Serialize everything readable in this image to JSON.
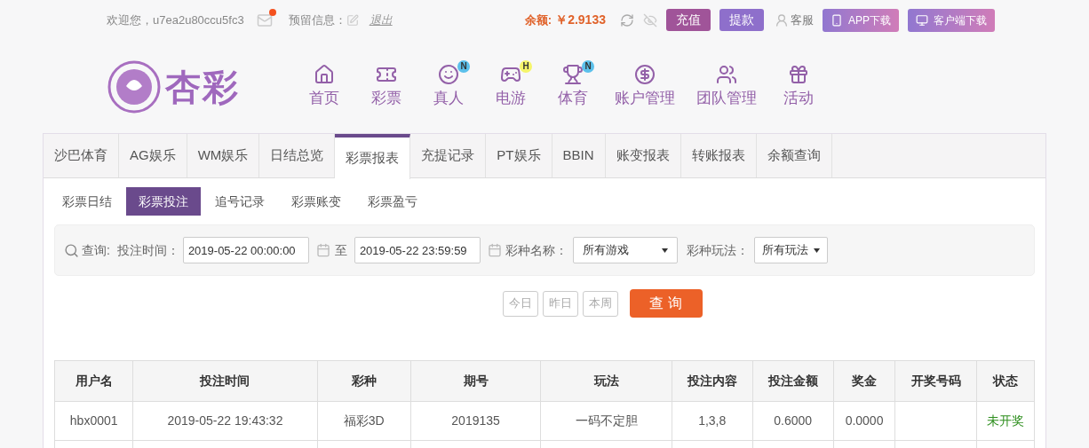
{
  "top_bar": {
    "welcome": "欢迎您，u7ea2u80ccu5fc3",
    "mail_unread": true,
    "reserved_label": "预留信息：",
    "logout": "退出",
    "balance_label": "余额:",
    "balance": "￥2.9133",
    "buttons": [
      {
        "label": "充值",
        "kind": "deposit"
      },
      {
        "label": "提款",
        "kind": "withdraw"
      }
    ],
    "service": "客服",
    "downloads": [
      {
        "label": "APP下载",
        "kind": "phone"
      },
      {
        "label": "客户端下载",
        "kind": "desktop"
      }
    ]
  },
  "logo_text": "杏彩",
  "nav": [
    {
      "label": "首页",
      "kind": "home"
    },
    {
      "label": "彩票",
      "kind": "ticket"
    },
    {
      "label": "真人",
      "kind": "person",
      "badge": "N",
      "color": "#5bc0eb"
    },
    {
      "label": "电游",
      "kind": "gamepad",
      "badge": "H",
      "color": "#f5f56a"
    },
    {
      "label": "体育",
      "kind": "trophy",
      "badge": "N",
      "color": "#5bc0eb"
    },
    {
      "label": "账户管理",
      "kind": "coin"
    },
    {
      "label": "团队管理",
      "kind": "team"
    },
    {
      "label": "活动",
      "kind": "gift"
    }
  ],
  "tabs": [
    {
      "label": "沙巴体育",
      "selected": false
    },
    {
      "label": "AG娱乐",
      "selected": false
    },
    {
      "label": "WM娱乐",
      "selected": false
    },
    {
      "label": "日结总览",
      "selected": false
    },
    {
      "label": "彩票报表",
      "selected": true
    },
    {
      "label": "充提记录",
      "selected": false
    },
    {
      "label": "PT娱乐",
      "selected": false
    },
    {
      "label": "BBIN",
      "selected": false
    },
    {
      "label": "账变报表",
      "selected": false
    },
    {
      "label": "转账报表",
      "selected": false
    },
    {
      "label": "余额查询",
      "selected": false
    }
  ],
  "subtabs": [
    {
      "label": "彩票日结",
      "selected": false
    },
    {
      "label": "彩票投注",
      "selected": true
    },
    {
      "label": "追号记录",
      "selected": false
    },
    {
      "label": "彩票账变",
      "selected": false
    },
    {
      "label": "彩票盈亏",
      "selected": false
    }
  ],
  "filters": {
    "query_label": "查询:",
    "time_label": "投注时间：",
    "start": "2019-05-22 00:00:00",
    "to": "至",
    "end": "2019-05-22 23:59:59",
    "game_label": "彩种名称：",
    "game": "所有游戏",
    "play_label": "彩种玩法：",
    "play": "所有玩法"
  },
  "quick_buttons": [
    "今日",
    "昨日",
    "本周"
  ],
  "search_button": "查 询",
  "table": {
    "columns": [
      "用户名",
      "投注时间",
      "彩种",
      "期号",
      "玩法",
      "投注内容",
      "投注金额",
      "奖金",
      "开奖号码",
      "状态"
    ],
    "rows": [
      {
        "cells": [
          "hbx0001",
          "2019-05-22 19:43:32",
          "福彩3D",
          "2019135",
          "一码不定胆",
          "1,3,8",
          "0.6000",
          "0.0000",
          "",
          "未开奖"
        ],
        "color": "#2f8f1f"
      }
    ]
  }
}
